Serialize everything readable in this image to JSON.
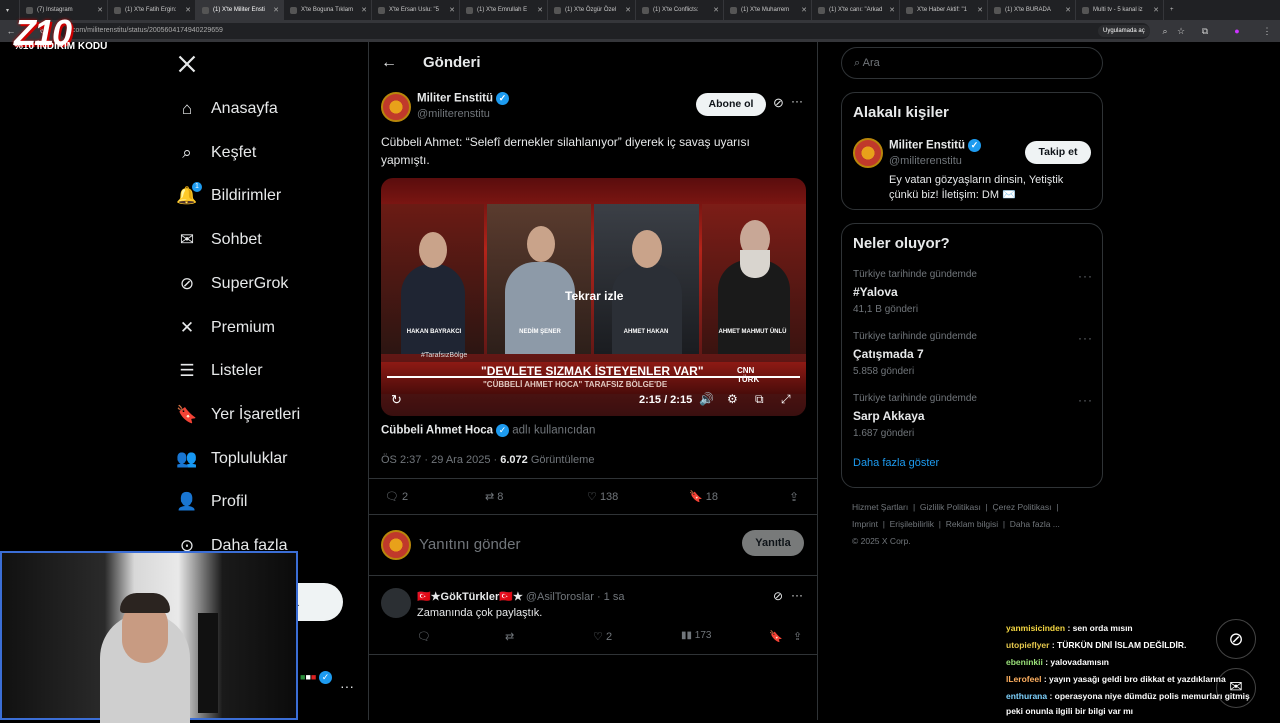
{
  "browser": {
    "tabs": [
      "(7) Instagram",
      "(1) X'te Fatih Ergin:",
      "(1) X'te Militer Ensti",
      "X'te Boguna Tıklam",
      "X'te Ersan Uslu: \"5",
      "(1) X'te Emrullah E",
      "(1) X'te Özgür Özel",
      "(1) X'te Conflicts:",
      "(1) X'te Muharrem",
      "(1) X'te canı: \"Arkad",
      "X'te Haber Aktif: \"1",
      "(1) X'te BURADA",
      "Multi tv - 5 kanal iz"
    ],
    "url": ".com/militerenstitu/status/2005604174940229659",
    "app_button": "Uygulamada aç"
  },
  "overlay": {
    "logo": "Z10",
    "promo": "%10 İNDİRİM KODU"
  },
  "nav": {
    "items": [
      {
        "label": "Anasayfa",
        "icon": "home-icon"
      },
      {
        "label": "Keşfet",
        "icon": "search-icon"
      },
      {
        "label": "Bildirimler",
        "icon": "bell-icon",
        "badge": "1"
      },
      {
        "label": "Sohbet",
        "icon": "mail-icon"
      },
      {
        "label": "SuperGrok",
        "icon": "grok-icon"
      },
      {
        "label": "Premium",
        "icon": "x-icon"
      },
      {
        "label": "Listeler",
        "icon": "list-icon"
      },
      {
        "label": "Yer İşaretleri",
        "icon": "bookmark-icon"
      },
      {
        "label": "Topluluklar",
        "icon": "people-icon"
      },
      {
        "label": "Profil",
        "icon": "person-icon"
      },
      {
        "label": "Daha fazla",
        "icon": "more-circle-icon"
      }
    ],
    "post_button_partial": "a"
  },
  "header": {
    "title": "Gönderi"
  },
  "post": {
    "author_name": "Militer Enstitü",
    "author_handle": "@militerenstitu",
    "follow_label": "Abone ol",
    "text": "Cübbeli Ahmet: “Selefî dernekler silahlanıyor” diyerek iç savaş uyarısı yapmıştı.",
    "video": {
      "replay_label": "Tekrar izle",
      "time": "2:15 / 2:15",
      "chyron_main": "\"DEVLETE SIZMAK İSTEYENLER VAR\"",
      "chyron_sub": "\"CÜBBELİ AHMET HOCA\" TARAFSIZ BÖLGE'DE",
      "hashtag": "#TarafsızBölge",
      "channel": "CNN TÜRK",
      "progress": 1.0,
      "guests": [
        "HAKAN BAYRAKCI",
        "NEDİM ŞENER",
        "AHMET HAKAN",
        "AHMET MAHMUT ÜNLÜ"
      ]
    },
    "tagged_user": "Cübbeli Ahmet Hoca",
    "tagged_suffix": "adlı kullanıcıdan",
    "time": "ÖS 2:37 · 29 Ara 2025",
    "views": "6.072",
    "views_label": "Görüntüleme",
    "stats": {
      "replies": "2",
      "reposts": "8",
      "likes": "138",
      "bookmarks": "18"
    }
  },
  "composer": {
    "placeholder": "Yanıtını gönder",
    "reply_label": "Yanıtla"
  },
  "reply": {
    "name": "🇹🇷★GökTürkler🇹🇷★",
    "handle": "@AsilToroslar",
    "time": "· 1 sa",
    "text": "Zamanında çok paylaştık.",
    "likes": "2",
    "views": "173"
  },
  "right": {
    "search_placeholder": "Ara",
    "related": {
      "title": "Alakalı kişiler",
      "name": "Militer Enstitü",
      "handle": "@militerenstitu",
      "follow_label": "Takip et",
      "bio": "Ey vatan gözyaşların dinsin, Yetiştik çünkü biz! İletişim: DM ✉️"
    },
    "trends": {
      "title": "Neler oluyor?",
      "items": [
        {
          "meta": "Türkiye tarihinde gündemde",
          "title": "#Yalova",
          "count": "41,1 B gönderi"
        },
        {
          "meta": "Türkiye tarihinde gündemde",
          "title": "Çatışmada 7",
          "count": "5.858 gönderi"
        },
        {
          "meta": "Türkiye tarihinde gündemde",
          "title": "Sarp Akkaya",
          "count": "1.687 gönderi"
        }
      ],
      "show_more": "Daha fazla göster"
    },
    "footer": [
      "Hizmet Şartları",
      "Gizlilik Politikası",
      "Çerez Politikası",
      "Imprint",
      "Erişilebilirlik",
      "Reklam bilgisi",
      "Daha fazla ...",
      "© 2025 X Corp."
    ]
  },
  "chat": [
    {
      "user": "yanmisicinden",
      "color": "#f5d742",
      "text": ": sen orda mısın"
    },
    {
      "user": "utopieflyer",
      "color": "#e6c84d",
      "text": ": TÜRKÜN DİNİ İSLAM DEĞİLDİR."
    },
    {
      "user": "ebeninkii",
      "color": "#9be27a",
      "text": ": yalovadamısın"
    },
    {
      "user": "lLerofeel",
      "color": "#ffb060",
      "text": ": yayın yasağı geldi bro dikkat et yazdıklarına"
    },
    {
      "user": "enthurana",
      "color": "#7fd3ff",
      "text": ": operasyona niye dümdüz polis memurları gitmiş"
    },
    {
      "user": "",
      "color": "#ffffff",
      "text": "peki onunla ilgili bir bilgi var mı"
    }
  ]
}
